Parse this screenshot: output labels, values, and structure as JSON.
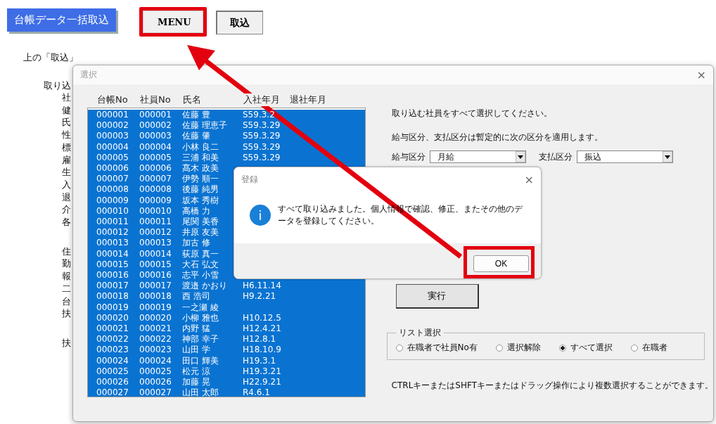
{
  "sheet": {
    "title_button": "台帳データ一括取込",
    "buttons": [
      {
        "label": "MENU",
        "highlighted": true
      },
      {
        "label": "取込",
        "highlighted": false
      }
    ],
    "instruction": "上の「取込」",
    "fields_heading": "取り込",
    "field_groups": [
      [
        "社",
        "健",
        "氏",
        "性",
        "標",
        "雇",
        "生",
        "入",
        "退",
        "介",
        "各"
      ],
      [
        "住",
        "勤",
        "報",
        "二",
        "台",
        "扶"
      ],
      [
        "扶"
      ]
    ]
  },
  "dialog": {
    "title": "選択",
    "close": "×",
    "columns": [
      "台帳No",
      "社員No",
      "氏名",
      "入社年月",
      "退社年月"
    ],
    "rows": [
      {
        "ledger_no": "000001",
        "employee_no": "000001",
        "name": "佐藤 豊",
        "joined": "S59.3.2",
        "selected": true
      },
      {
        "ledger_no": "000002",
        "employee_no": "000002",
        "name": "佐藤 理恵子",
        "joined": "S59.3.29",
        "selected": true
      },
      {
        "ledger_no": "000003",
        "employee_no": "000003",
        "name": "佐藤 肇",
        "joined": "S59.3.29",
        "selected": true
      },
      {
        "ledger_no": "000004",
        "employee_no": "000004",
        "name": "小林 良二",
        "joined": "S59.3.29",
        "selected": true
      },
      {
        "ledger_no": "000005",
        "employee_no": "000005",
        "name": "三浦 和美",
        "joined": "S59.3.29",
        "selected": true
      },
      {
        "ledger_no": "000006",
        "employee_no": "000006",
        "name": "髙木 政美",
        "selected": true
      },
      {
        "ledger_no": "000007",
        "employee_no": "000007",
        "name": "伊勢 順一",
        "selected": true
      },
      {
        "ledger_no": "000008",
        "employee_no": "000008",
        "name": "後藤 純男",
        "selected": true
      },
      {
        "ledger_no": "000009",
        "employee_no": "000009",
        "name": "坂本 秀樹",
        "selected": true
      },
      {
        "ledger_no": "000010",
        "employee_no": "000010",
        "name": "高橋 力",
        "selected": true
      },
      {
        "ledger_no": "000011",
        "employee_no": "000011",
        "name": "尾関 美香",
        "selected": true
      },
      {
        "ledger_no": "000012",
        "employee_no": "000012",
        "name": "井原 友美",
        "selected": true
      },
      {
        "ledger_no": "000013",
        "employee_no": "000013",
        "name": "加古 修",
        "selected": true
      },
      {
        "ledger_no": "000014",
        "employee_no": "000014",
        "name": "荻原 真一",
        "selected": true
      },
      {
        "ledger_no": "000015",
        "employee_no": "000015",
        "name": "大石 弘文",
        "selected": true
      },
      {
        "ledger_no": "000016",
        "employee_no": "000016",
        "name": "志平 小雪",
        "selected": true
      },
      {
        "ledger_no": "000017",
        "employee_no": "000017",
        "name": "渡邉 かおり",
        "joined": "H6.11.14",
        "selected": true
      },
      {
        "ledger_no": "000018",
        "employee_no": "000018",
        "name": "西 浩司",
        "joined": "H9.2.21",
        "selected": true
      },
      {
        "ledger_no": "000019",
        "employee_no": "000019",
        "name": "一之瀬 綾",
        "selected": true
      },
      {
        "ledger_no": "000020",
        "employee_no": "000020",
        "name": "小柳 雅也",
        "joined": "H10.12.5",
        "selected": true
      },
      {
        "ledger_no": "000021",
        "employee_no": "000021",
        "name": "内野 猛",
        "joined": "H12.4.21",
        "selected": true
      },
      {
        "ledger_no": "000022",
        "employee_no": "000022",
        "name": "神部 幸子",
        "joined": "H12.8.1",
        "selected": true
      },
      {
        "ledger_no": "000023",
        "employee_no": "000023",
        "name": "山田 学",
        "joined": "H18.10.9",
        "selected": true
      },
      {
        "ledger_no": "000024",
        "employee_no": "000024",
        "name": "田口 輝美",
        "joined": "H19.3.1",
        "selected": true
      },
      {
        "ledger_no": "000025",
        "employee_no": "000025",
        "name": "松元 涼",
        "joined": "H19.3.21",
        "selected": true
      },
      {
        "ledger_no": "000026",
        "employee_no": "000026",
        "name": "加藤 晃",
        "joined": "H22.9.21",
        "selected": true
      },
      {
        "ledger_no": "000027",
        "employee_no": "000027",
        "name": "山田 太郎",
        "joined": "R4.6.1",
        "selected": true
      }
    ],
    "prompt": "取り込む社員をすべて選択してください。",
    "note": "給与区分、支払区分は暫定的に次の区分を適用します。",
    "dropdowns": [
      {
        "label": "給与区分",
        "value": "月給"
      },
      {
        "label": "支払区分",
        "value": "振込"
      }
    ],
    "run_button": "実行",
    "list_select": {
      "title": "リスト選択",
      "options": [
        {
          "label": "在職者で社員No有",
          "selected": false
        },
        {
          "label": "選択解除",
          "selected": false
        },
        {
          "label": "すべて選択",
          "selected": true
        },
        {
          "label": "在職者",
          "selected": false
        }
      ]
    },
    "footer": "CTRLキーまたはSHFTキーまたはドラッグ操作により複数選択することができます。"
  },
  "message_box": {
    "title": "登録",
    "close": "×",
    "icon": "i",
    "message": "すべて取り込みました。個人情報で確認、修正、またその他のデータを登録してください。",
    "ok_button": "OK",
    "ok_highlighted": true
  }
}
